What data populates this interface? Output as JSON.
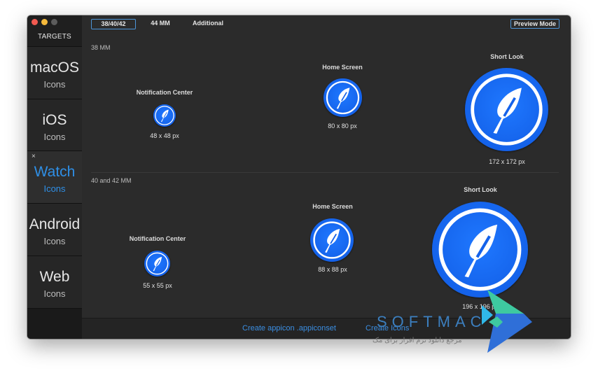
{
  "sidebar": {
    "title": "TARGETS",
    "close_glyph": "×",
    "items": [
      {
        "title": "macOS",
        "subtitle": "Icons"
      },
      {
        "title": "iOS",
        "subtitle": "Icons"
      },
      {
        "title": "Watch",
        "subtitle": "Icons"
      },
      {
        "title": "Android",
        "subtitle": "Icons"
      },
      {
        "title": "Web",
        "subtitle": "Icons"
      }
    ]
  },
  "toolbar": {
    "tabs": [
      "38/40/42",
      "44 MM",
      "Additional"
    ],
    "preview_mode": "Preview Mode"
  },
  "sections": [
    {
      "title": "38 MM",
      "icons": [
        {
          "label": "Notification Center",
          "size": "48 x 48 px"
        },
        {
          "label": "Home Screen",
          "size": "80 x 80 px"
        },
        {
          "label": "Short Look",
          "size": "172 x 172 px"
        }
      ]
    },
    {
      "title": "40 and 42 MM",
      "icons": [
        {
          "label": "Notification Center",
          "size": "55 x 55 px"
        },
        {
          "label": "Home Screen",
          "size": "88 x 88 px"
        },
        {
          "label": "Short Look",
          "size": "196 x 196 px"
        }
      ]
    }
  ],
  "bottom": {
    "create_appiconset": "Create appicon .appiconset",
    "create_icons": "Create Icons"
  },
  "watermark": {
    "title": "SOFTMAC",
    "subtitle": "مرجع دانلود نرم افزار برای مک"
  },
  "colors": {
    "accent": "#2f8fe6",
    "icon_blue": "#1462ea",
    "window_bg": "#2b2b2b",
    "sidebar_bg": "#1f1f1f"
  },
  "icon_names": {
    "app_icon": "feather-icon",
    "watermark_logo": "softmac-logo-icon"
  }
}
